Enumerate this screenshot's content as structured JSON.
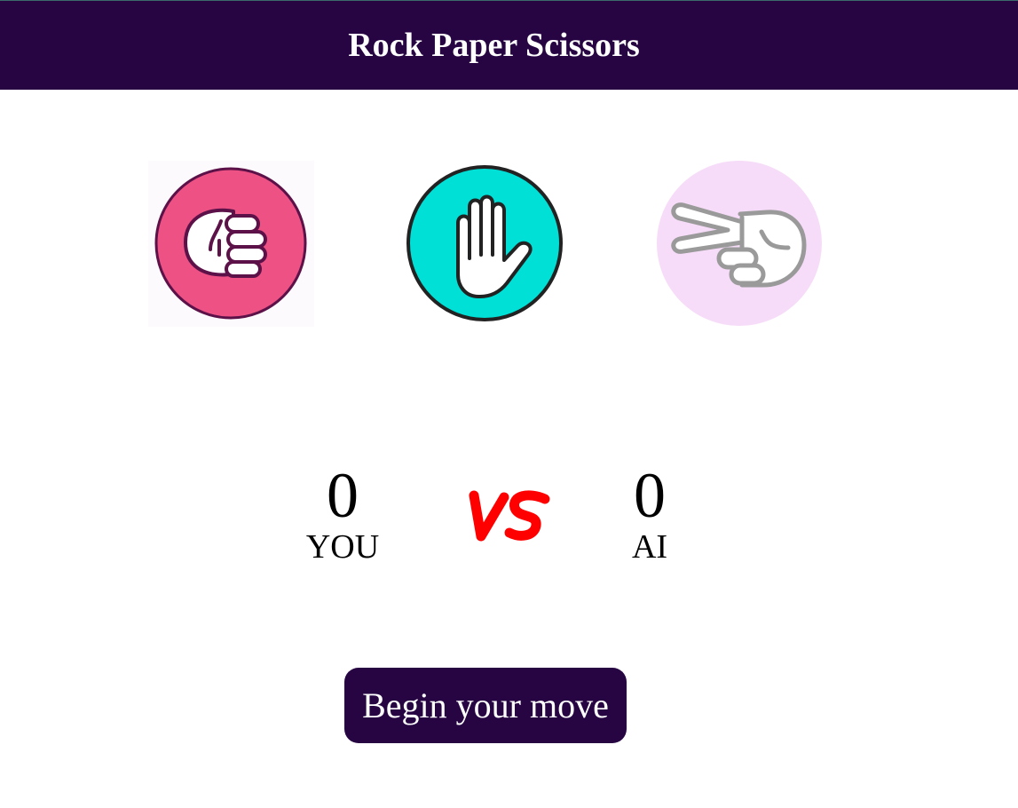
{
  "header": {
    "title": "Rock Paper Scissors"
  },
  "choices": [
    {
      "name": "rock",
      "icon": "fist-icon",
      "bg": "#ee5285"
    },
    {
      "name": "paper",
      "icon": "open-hand-icon",
      "bg": "#00e0d6"
    },
    {
      "name": "scissors",
      "icon": "scissors-hand-icon",
      "bg": "#f6dcf8"
    }
  ],
  "scoreboard": {
    "player": {
      "score": "0",
      "label": "YOU"
    },
    "ai": {
      "score": "0",
      "label": "AI"
    },
    "vs_color": "#ff0000"
  },
  "begin_button": {
    "label": "Begin your move",
    "bg": "#260542"
  },
  "colors": {
    "header_bg": "#260542"
  }
}
